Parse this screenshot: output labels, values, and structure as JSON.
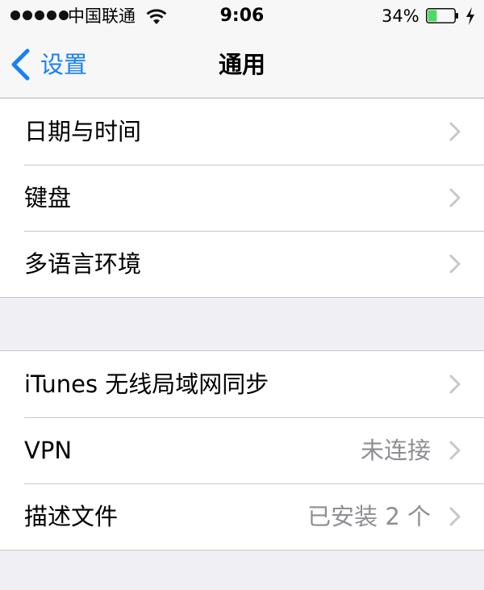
{
  "status_bar": {
    "carrier": "中国联通",
    "time": "9:06",
    "battery_percent": "34%",
    "battery_level": 0.34,
    "signal_bars": 5,
    "icons": [
      "signal-dots-icon",
      "wifi-icon",
      "battery-icon",
      "charging-bolt-icon"
    ]
  },
  "nav": {
    "back_label": "设置",
    "title": "通用"
  },
  "groups": [
    {
      "rows": [
        {
          "label": "日期与时间",
          "value": ""
        },
        {
          "label": "键盘",
          "value": ""
        },
        {
          "label": "多语言环境",
          "value": ""
        }
      ]
    },
    {
      "rows": [
        {
          "label": "iTunes 无线局域网同步",
          "value": ""
        },
        {
          "label": "VPN",
          "value": "未连接"
        },
        {
          "label": "描述文件",
          "value": "已安装 2 个"
        }
      ]
    }
  ],
  "colors": {
    "accent": "#1a7ff6",
    "background": "#efeff4",
    "battery_fill": "#4cd964",
    "secondary_text": "#8e8e93",
    "chevron": "#c7c7cc"
  }
}
